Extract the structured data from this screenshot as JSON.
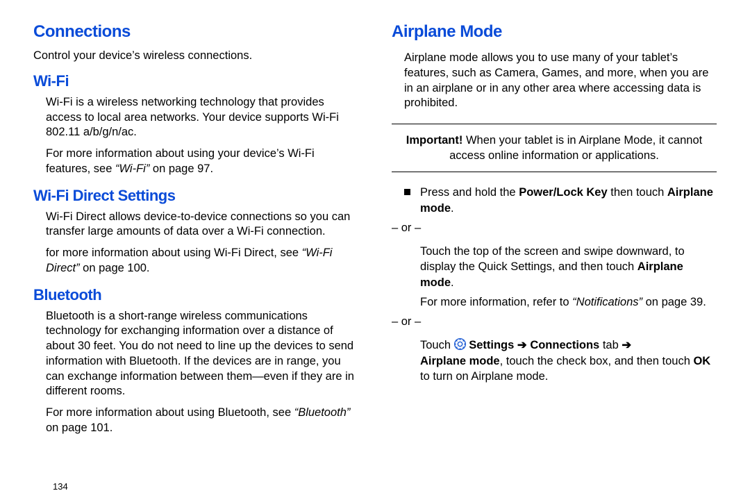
{
  "left": {
    "connections_h": "Connections",
    "connections_intro": "Control your device’s wireless connections.",
    "wifi_h": "Wi-Fi",
    "wifi_p1": "Wi-Fi is a wireless networking technology that provides access to local area networks. Your device supports Wi-Fi 802.11 a/b/g/n/ac.",
    "wifi_p2a": "For more information about using your device’s Wi-Fi features, see ",
    "wifi_p2x": "“Wi-Fi”",
    "wifi_p2b": " on page 97.",
    "wfd_h": "Wi-Fi Direct Settings",
    "wfd_p1": "Wi-Fi Direct allows device-to-device connections so you can transfer large amounts of data over a Wi-Fi connection.",
    "wfd_p2a": "for more information about using Wi-Fi Direct, see ",
    "wfd_p2x": "“Wi-Fi Direct”",
    "wfd_p2b": " on page 100.",
    "bt_h": "Bluetooth",
    "bt_p1": "Bluetooth is a short-range wireless communications technology for exchanging information over a distance of about 30 feet. You do not need to line up the devices to send information with Bluetooth. If the devices are in range, you can exchange information between them—even if they are in different rooms.",
    "bt_p2a": "For more information about using Bluetooth, see ",
    "bt_p2x": "“Bluetooth”",
    "bt_p2b": " on page 101.",
    "page_num": "134"
  },
  "right": {
    "air_h": "Airplane Mode",
    "air_p1": "Airplane mode allows you to use many of your tablet’s features, such as Camera, Games, and more, when you are in an airplane or in any other area where accessing data is prohibited.",
    "imp_lead": "Important!",
    "imp_body": " When your tablet is in Airplane Mode, it cannot access online information or applications.",
    "step1_a": "Press and hold the ",
    "step1_b": "Power/Lock Key",
    "step1_c": " then touch ",
    "step1_d": "Airplane mode",
    "step1_e": ".",
    "or": "– or –",
    "step2_a": "Touch the top of the screen and swipe downward, to display the Quick Settings, and then touch ",
    "step2_b": "Airplane mode",
    "step2_c": ".",
    "step2_more_a": "For more information, refer to ",
    "step2_more_x": "“Notifications”",
    "step2_more_b": " on page 39.",
    "step3_a": "Touch ",
    "step3_settings": " Settings",
    "step3_arrow": " ➔ ",
    "step3_conn": "Connections",
    "step3_tab": " tab ",
    "step3_air": "Airplane mode",
    "step3_d": ", touch the check box, and then touch ",
    "step3_ok": "OK",
    "step3_e": " to turn on Airplane mode."
  }
}
